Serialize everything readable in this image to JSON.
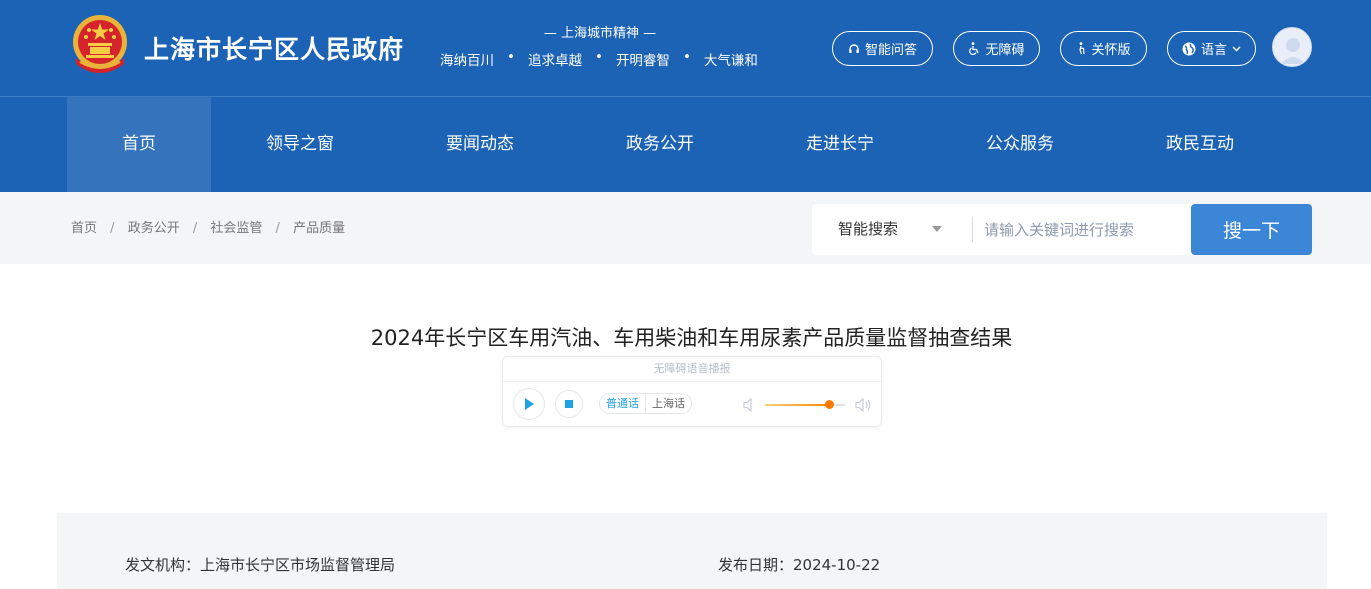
{
  "header": {
    "site_title": "上海市长宁区人民政府",
    "spirit_title": "— 上海城市精神 —",
    "spirit_items": [
      "海纳百川",
      "追求卓越",
      "开明睿智",
      "大气谦和"
    ],
    "spirit_separator": "•",
    "buttons": {
      "qa": "智能问答",
      "accessibility": "无障碍",
      "elderly": "关怀版",
      "language": "语言"
    },
    "colors": {
      "background": "#1c63b5",
      "nav_active": "#3574bd"
    }
  },
  "nav": {
    "items": [
      "首页",
      "领导之窗",
      "要闻动态",
      "政务公开",
      "走进长宁",
      "公众服务",
      "政民互动"
    ],
    "active_index": 0
  },
  "breadcrumb": {
    "items": [
      "首页",
      "政务公开",
      "社会监管",
      "产品质量"
    ],
    "separator": "/"
  },
  "search": {
    "scope_label": "智能搜索",
    "placeholder": "请输入关键词进行搜索",
    "value": "",
    "button_label": "搜一下",
    "button_color": "#3b86d6"
  },
  "article": {
    "title": "2024年长宁区车用汽油、车用柴油和车用尿素产品质量监督抽查结果",
    "tts": {
      "header": "无障碍语音播报",
      "lang_options": [
        "普通话",
        "上海话"
      ],
      "selected_lang": "普通话",
      "volume_fraction": 0.8,
      "accent_color": "#20a3e6"
    },
    "info": {
      "issuer": "发文机构：上海市长宁区市场监督管理局",
      "date": "发布日期：2024-10-22"
    }
  }
}
